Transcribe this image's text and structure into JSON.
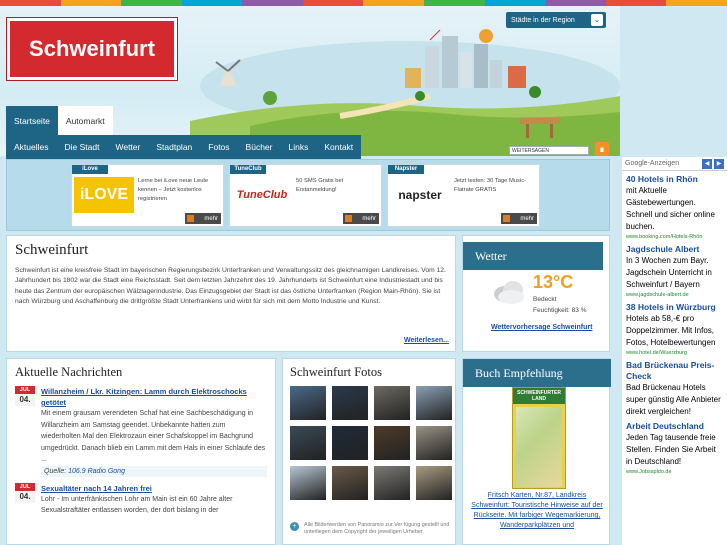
{
  "stripe_colors": [
    "#e94b3c",
    "#f7a21b",
    "#3db54a",
    "#00a6d6",
    "#8d5ba7",
    "#e94b3c",
    "#f7a21b",
    "#3db54a",
    "#00a6d6",
    "#8d5ba7",
    "#e94b3c",
    "#f7a21b"
  ],
  "site": {
    "title": "Schweinfurt",
    "region_button": "Städte in der Region"
  },
  "tabs": [
    {
      "label": "Startseite"
    },
    {
      "label": "Automarkt"
    }
  ],
  "nav": [
    {
      "label": "Aktuelles"
    },
    {
      "label": "Die Stadt"
    },
    {
      "label": "Wetter"
    },
    {
      "label": "Stadtplan"
    },
    {
      "label": "Fotos"
    },
    {
      "label": "Bücher"
    },
    {
      "label": "Links"
    },
    {
      "label": "Kontakt"
    }
  ],
  "share": {
    "label": "WEITERSAGEN"
  },
  "promos": [
    {
      "header": "iLove",
      "logo": "iLOVE",
      "text": "Lerne bei iLove neue Leute kennen – Jetzt kostenlos registrieren",
      "more": "mehr"
    },
    {
      "header": "TuneClub",
      "logo": "TuneClub",
      "text": "50 SMS Gratis bei Erstanmeldung!",
      "more": "mehr"
    },
    {
      "header": "Napster",
      "logo": "napster",
      "text": "Jetzt testen: 30 Tage Music-Flatrate GRATIS",
      "more": "mehr"
    }
  ],
  "ads": {
    "label": "Google-Anzeigen",
    "items": [
      {
        "title": "40 Hotels in Rhön",
        "body": "mit Aktuelle Gästebewertungen. Schnell und sicher online buchen.",
        "url": "www.booking.com/Hotels-Rhön"
      },
      {
        "title": "Jagdschule Albert",
        "body": "In 3 Wochen zum Bayr. Jagdschein Unterricht in Schweinfurt / Bayern",
        "url": "www.jagdschule-albert.de"
      },
      {
        "title": "38 Hotels in Würzburg",
        "body": "Hotels ab 58,-€ pro Doppelzimmer. Mit Infos, Fotos, Hotelbewertungen",
        "url": "www.hotel.de/Wuerzburg"
      },
      {
        "title": "Bad Brückenau Preis-Check",
        "body": "Bad Brückenau Hotels super günstig Alle Anbieter direkt vergleichen!",
        "url": ""
      },
      {
        "title": "Arbeit Deutschland",
        "body": "Jeden Tag tausende freie Stellen. Finden Sie Arbeit in Deutschland!",
        "url": "www.Jobsspido.de"
      }
    ]
  },
  "intro": {
    "title": "Schweinfurt",
    "text": "Schweinfurt ist eine kreisfreie Stadt im bayerischen Regierungsbezirk Unterfranken und Verwaltungssitz des gleichnamigen Landkreises. Vom 12. Jahrhundert bis 1802 war die Stadt eine Reichsstadt. Seit dem letzten Jahrzehnt des 19. Jahrhunderts ist Schweinfurt eine Industriestadt und bis heute das Zentrum der europäischen Wälzlagerindustrie. Das Einzugsgebiet der Stadt ist das östliche Unterfranken (Region Main-Rhön). Sie ist nach Würzburg und Aschaffenburg die drittgrößte Stadt Unterfrankens und wirbt für sich mit dem Motto Industrie und Kunst.",
    "more": "Weiterlesen..."
  },
  "weather": {
    "title": "Wetter",
    "temp": "13°C",
    "condition": "Bedeckt",
    "humidity": "Feuchtigkeit: 83 %",
    "link": "Wettervorhersage Schweinfurt"
  },
  "news": {
    "title": "Aktuelle Nachrichten",
    "items": [
      {
        "month": "JUL",
        "day": "04.",
        "title": "Willanzheim / Lkr. Kitzingen: Lamm durch Elektroschocks getötet",
        "body": "Mit einem grausam verendeten Schaf hat eine Sachbeschädigung in Willanzheim am Samstag geendet. Unbekannte hatten zum wiederholten Mal den Elektrozaun einer Schafskoppel im Bachgrund umgedrückt. Danach blieb ein Lamm mit dem Hals in einer Schlaufe des ...",
        "source_label": "Quelle:",
        "source": "106.9 Radio Gong"
      },
      {
        "month": "JUL",
        "day": "04.",
        "title": "Sexualtäter nach 14 Jahren frei",
        "body": "Lohr - Im unterfränkischen Lohr am Main ist ein 60 Jahre alter Sexualstraftäter entlassen worden, der dort bislang in der",
        "source_label": "",
        "source": ""
      }
    ]
  },
  "photos": {
    "title": "Schweinfurt Fotos",
    "note": "Alle Bilderwerden von Panoramio zur Ver fügung gestellt und unterliegen dem Copyright der jeweiligen Urheber.",
    "tiles": [
      "#4a6a8a",
      "#2b3a4a",
      "#6d6a62",
      "#8aa0b5",
      "#3b4a55",
      "#1f2a3a",
      "#4e3b2a",
      "#9a9286",
      "#b7c6d4",
      "#6a5a48",
      "#7c7a76",
      "#a89c82"
    ]
  },
  "book": {
    "title": "Buch Empfehlung",
    "cover_title": "SCHWEINFURTER LAND",
    "caption": "Fritsch Karten, Nr.87, Landkreis Schweinfurt: Touristische Hinweise auf der Rückseite. Mit farbiger Wegemarkierung, Wanderparkplätzen und"
  }
}
